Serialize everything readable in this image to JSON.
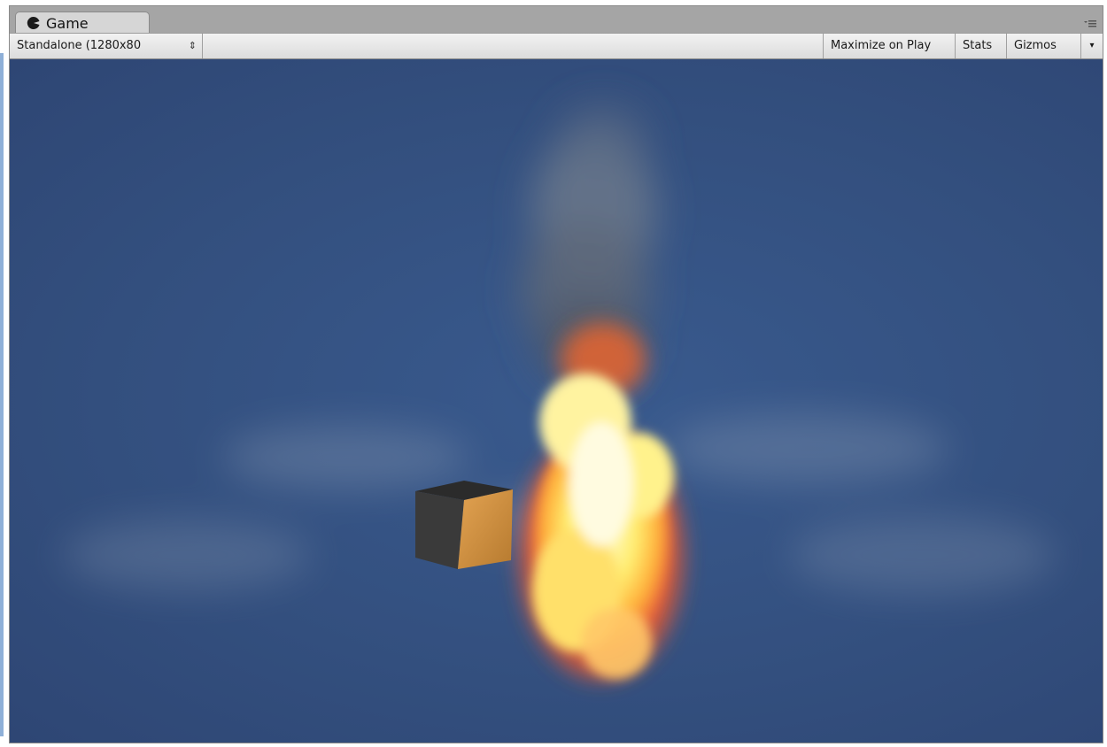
{
  "window": {
    "tab": {
      "label": "Game",
      "icon": "pacman-game-icon"
    },
    "panel_menu_icon": "panel-menu-icon"
  },
  "toolbar": {
    "resolution": "Standalone (1280x80",
    "resolution_arrows": "⇕",
    "maximize_on_play": "Maximize on Play",
    "stats": "Stats",
    "gizmos": "Gizmos",
    "gizmos_arrow": "▾"
  },
  "scene": {
    "background_color": "#355488",
    "objects": [
      "cube",
      "fire-particle-effect",
      "smoke-column"
    ]
  }
}
